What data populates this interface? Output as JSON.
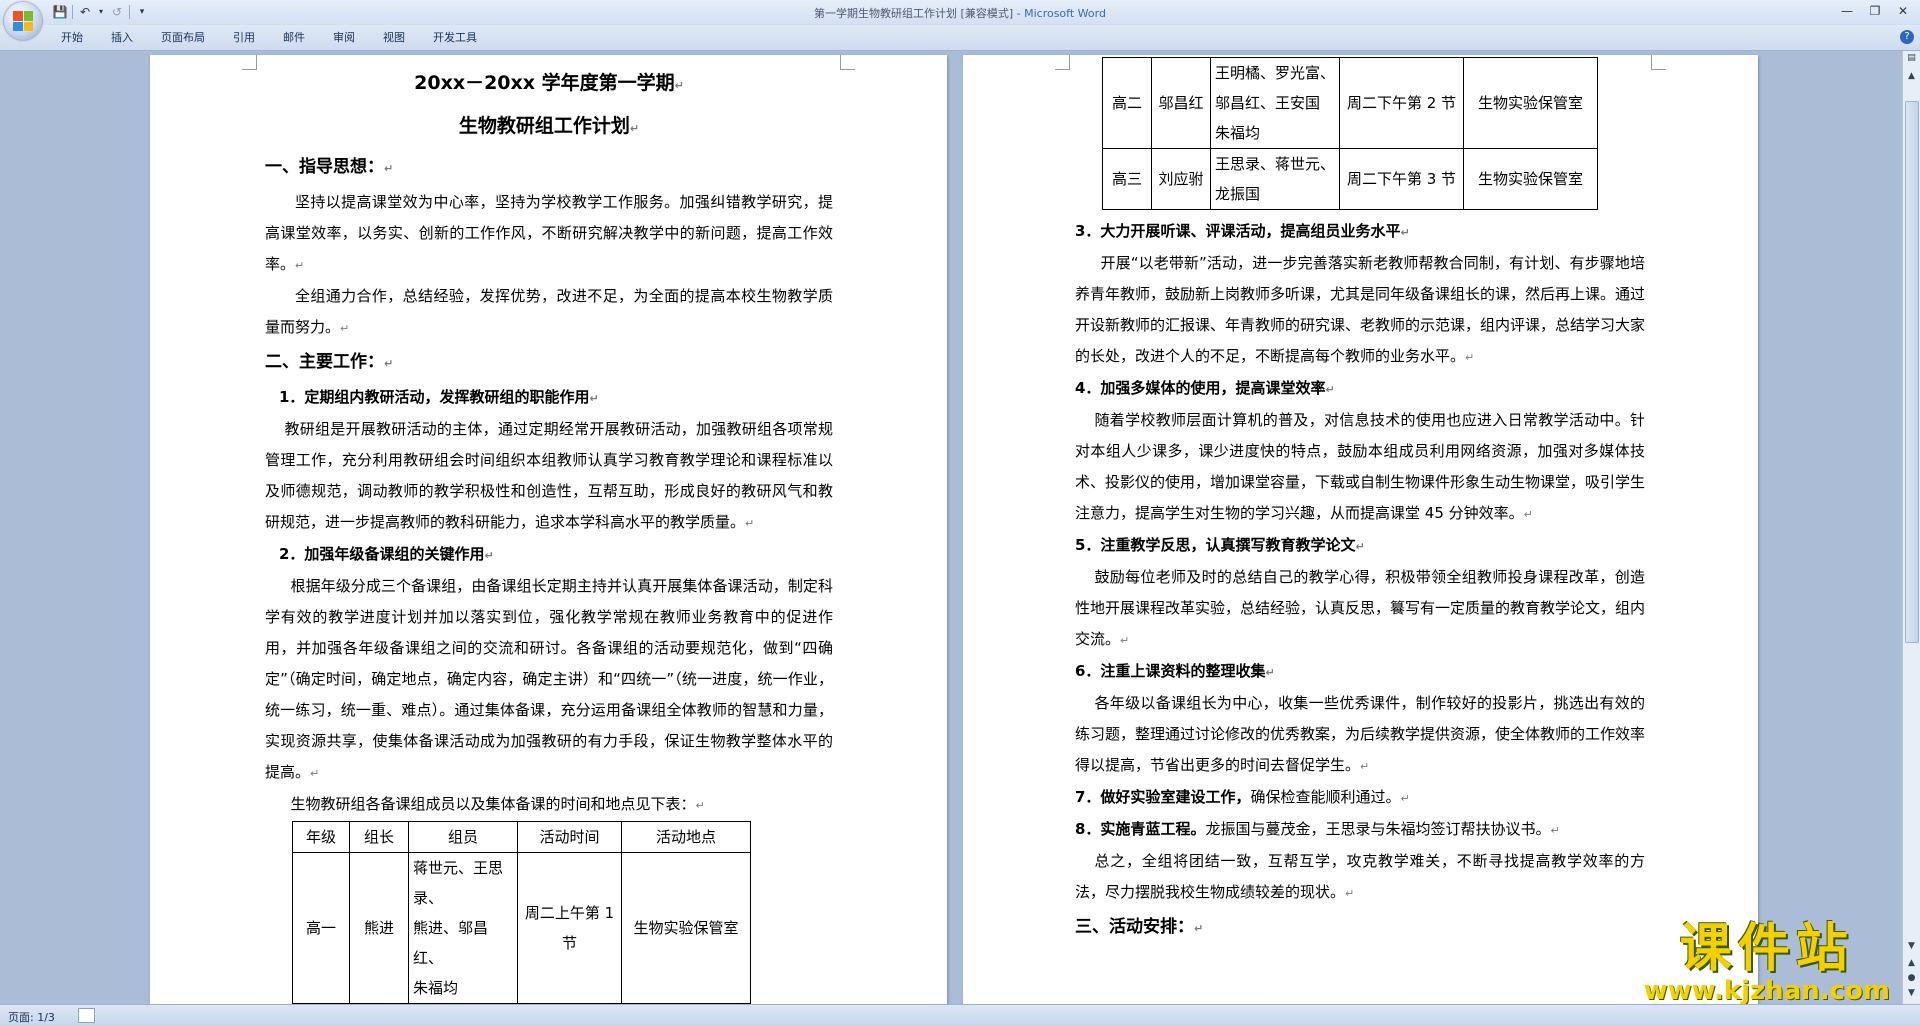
{
  "window": {
    "title": "第一学期生物教研组工作计划 [兼容模式] - ",
    "app_name": "Microsoft Word"
  },
  "quick_access": {
    "save_icon": "save-icon",
    "undo_icon": "undo-icon",
    "redo_icon": "redo-icon",
    "customize_icon": "customize-icon"
  },
  "ribbon": {
    "tabs": [
      "开始",
      "插入",
      "页面布局",
      "引用",
      "邮件",
      "审阅",
      "视图",
      "开发工具"
    ]
  },
  "status": {
    "page": "页面: 1/3"
  },
  "watermark": {
    "main": "课件站",
    "url": "www.kjzhan.com"
  },
  "document": {
    "title1": "20xx－20xx 学年度第一学期",
    "title2": "生物教研组工作计划",
    "s1_heading": "一、指导思想：",
    "s1_p1": "坚持以提高课堂效为中心率，坚持为学校教学工作服务。加强纠错教学研究，提高课堂效率，以务实、创新的工作作风，不断研究解决教学中的新问题，提高工作效率。",
    "s1_p2": "全组通力合作，总结经验，发挥优势，改进不足，为全面的提高本校生物教学质量而努力。",
    "s2_heading": "二、主要工作：",
    "i1_heading": "1．定期组内教研活动，发挥教研组的职能作用",
    "i1_text": "教研组是开展教研活动的主体，通过定期经常开展教研活动，加强教研组各项常规管理工作，充分利用教研组会时间组织本组教师认真学习教育教学理论和课程标准以及师德规范，调动教师的教学积极性和创造性，互帮互助，形成良好的教研风气和教研规范，进一步提高教师的教科研能力，追求本学科高水平的教学质量。",
    "i2_heading": "2．加强年级备课组的关键作用",
    "i2_text": "根据年级分成三个备课组，由备课组长定期主持并认真开展集体备课活动，制定科学有效的教学进度计划并加以落实到位，强化教学常规在教师业务教育中的促进作用，并加强各年级备课组之间的交流和研讨。各备课组的活动要规范化，做到“四确定”（确定时间，确定地点，确定内容，确定主讲）和“四统一”（统一进度，统一作业，统一练习，统一重、难点）。通过集体备课，充分运用备课组全体教师的智慧和力量，实现资源共享，使集体备课活动成为加强教研的有力手段，保证生物教学整体水平的提高。",
    "table_caption": "生物教研组各备课组成员以及集体备课的时间和地点见下表：",
    "table_headers": [
      "年级",
      "组长",
      "组员",
      "活动时间",
      "活动地点"
    ],
    "rows": [
      {
        "grade": "高一",
        "leader": "熊进",
        "m1": "蒋世元、王思录、",
        "m2": "熊进、邬昌红、",
        "m3": "朱福均",
        "time": "周二上午第 1 节",
        "place": "生物实验保管室"
      },
      {
        "grade": "高二",
        "leader": "邬昌红",
        "m1": "王明橘、罗光富、",
        "m2": "邬昌红、王安国",
        "m3": "朱福均",
        "time": "周二下午第 2 节",
        "place": "生物实验保管室"
      },
      {
        "grade": "高三",
        "leader": "刘应驸",
        "m1": "王思录、蒋世元、",
        "m2": "龙振国",
        "time": "周二下午第 3 节",
        "place": "生物实验保管室"
      }
    ],
    "i3_heading": "3．大力开展听课、评课活动，提高组员业务水平",
    "i3_text": "开展“以老带新”活动，进一步完善落实新老教师帮教合同制，有计划、有步骤地培养青年教师，鼓励新上岗教师多听课，尤其是同年级备课组长的课，然后再上课。通过开设新教师的汇报课、年青教师的研究课、老教师的示范课，组内评课，总结学习大家的长处，改进个人的不足，不断提高每个教师的业务水平。",
    "i4_heading": "4．加强多媒体的使用，提高课堂效率",
    "i4_text": "随着学校教师层面计算机的普及，对信息技术的使用也应进入日常教学活动中。针对本组人少课多，课少进度快的特点，鼓励本组成员利用网络资源，加强对多媒体技术、投影仪的使用，增加课堂容量，下载或自制生物课件形象生动生物课堂，吸引学生注意力，提高学生对生物的学习兴趣，从而提高课堂 45 分钟效率。",
    "i5_heading": "5．注重教学反思，认真撰写教育教学论文",
    "i5_text": "鼓励每位老师及时的总结自己的教学心得，积极带领全组教师投身课程改革，创造性地开展课程改革实验，总结经验，认真反思，籑写有一定质量的教育教学论文，组内交流。",
    "i6_heading": "6．注重上课资料的整理收集",
    "i6_text": "各年级以备课组长为中心，收集一些优秀课件，制作较好的投影片，挑选出有效的练习题，整理通过讨论修改的优秀教案，为后续教学提供资源，使全体教师的工作效率得以提高，节省出更多的时间去督促学生。",
    "i7_bold": "7．做好实验室建设工作，",
    "i7_rest": "确保检查能顺利通过。",
    "i8_bold": "8．实施青蓝工程。",
    "i8_rest": "龙振国与蔓茂金，王思录与朱福均签订帮扶协议书。",
    "summary": "总之，全组将团结一致，互帮互学，攻克教学难关，不断寻找提高教学效率的方法，尽力摆脱我校生物成绩较差的现状。",
    "s3_heading": "三、活动安排："
  }
}
